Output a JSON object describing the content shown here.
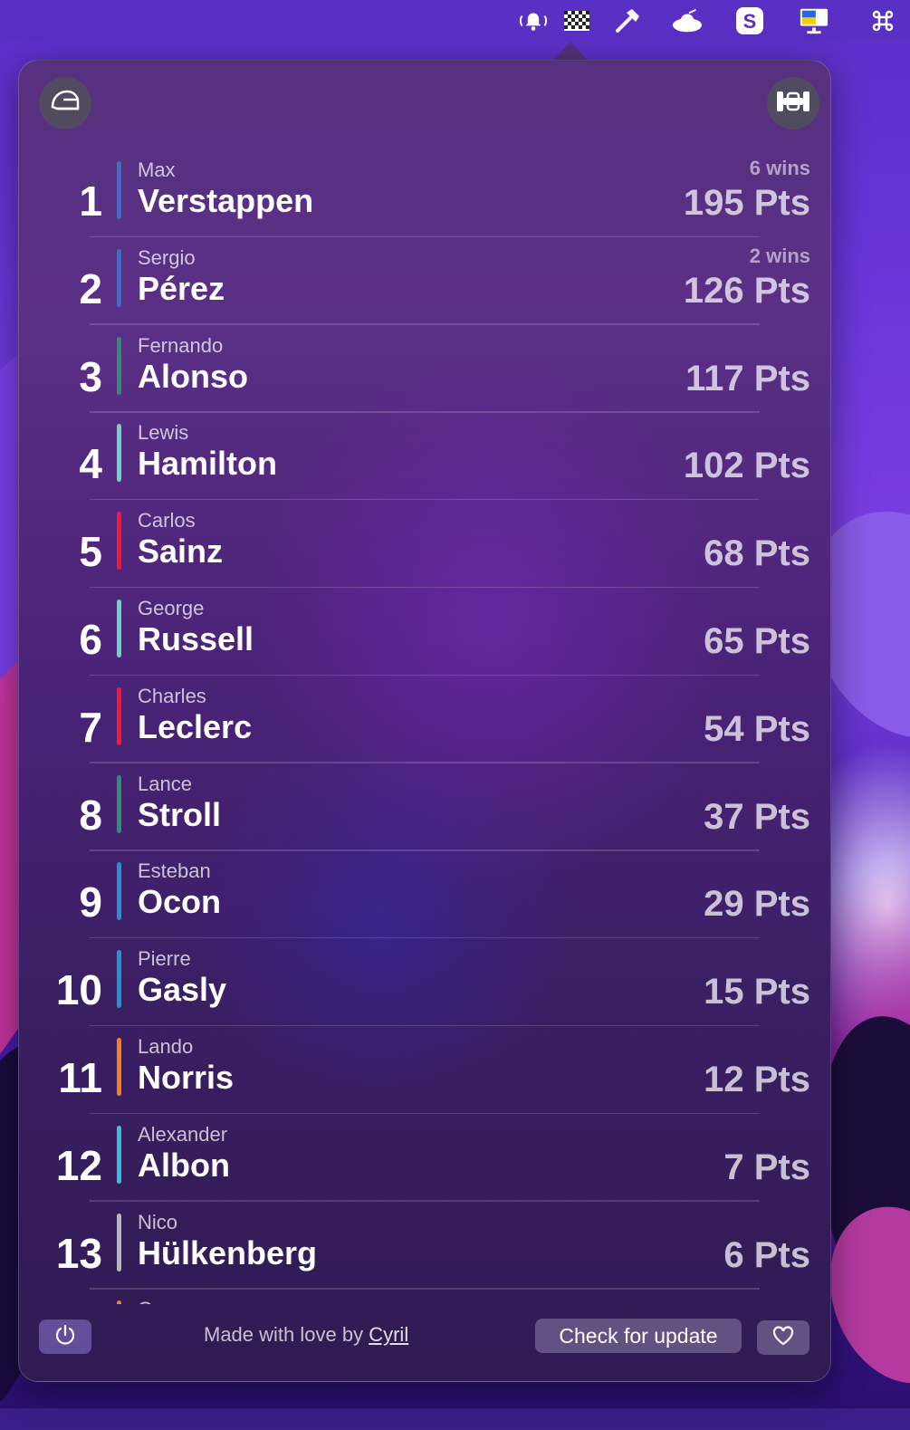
{
  "menubar": {
    "icons": [
      "bell-broadcast-icon",
      "checkered-flag-icon",
      "hammer-icon",
      "flying-saucer-icon",
      "s-app-icon",
      "display-flag-icon",
      "command-key-icon"
    ]
  },
  "header": {
    "left_icon": "helmet-icon",
    "right_icon": "f1-car-icon"
  },
  "standings": [
    {
      "position": "1",
      "first": "Max",
      "last": "Verstappen",
      "wins": "6 wins",
      "points": "195 Pts",
      "team_color": "#3671C6"
    },
    {
      "position": "2",
      "first": "Sergio",
      "last": "Pérez",
      "wins": "2 wins",
      "points": "126 Pts",
      "team_color": "#3671C6"
    },
    {
      "position": "3",
      "first": "Fernando",
      "last": "Alonso",
      "wins": "",
      "points": "117 Pts",
      "team_color": "#358C75"
    },
    {
      "position": "4",
      "first": "Lewis",
      "last": "Hamilton",
      "wins": "",
      "points": "102 Pts",
      "team_color": "#6CD3BF"
    },
    {
      "position": "5",
      "first": "Carlos",
      "last": "Sainz",
      "wins": "",
      "points": "68 Pts",
      "team_color": "#F91536"
    },
    {
      "position": "6",
      "first": "George",
      "last": "Russell",
      "wins": "",
      "points": "65 Pts",
      "team_color": "#6CD3BF"
    },
    {
      "position": "7",
      "first": "Charles",
      "last": "Leclerc",
      "wins": "",
      "points": "54 Pts",
      "team_color": "#F91536"
    },
    {
      "position": "8",
      "first": "Lance",
      "last": "Stroll",
      "wins": "",
      "points": "37 Pts",
      "team_color": "#358C75"
    },
    {
      "position": "9",
      "first": "Esteban",
      "last": "Ocon",
      "wins": "",
      "points": "29 Pts",
      "team_color": "#2293D1"
    },
    {
      "position": "10",
      "first": "Pierre",
      "last": "Gasly",
      "wins": "",
      "points": "15 Pts",
      "team_color": "#2293D1"
    },
    {
      "position": "11",
      "first": "Lando",
      "last": "Norris",
      "wins": "",
      "points": "12 Pts",
      "team_color": "#F58020"
    },
    {
      "position": "12",
      "first": "Alexander",
      "last": "Albon",
      "wins": "",
      "points": "7 Pts",
      "team_color": "#37BEDD"
    },
    {
      "position": "13",
      "first": "Nico",
      "last": "Hülkenberg",
      "wins": "",
      "points": "6 Pts",
      "team_color": "#B6BABD"
    },
    {
      "position": "",
      "first": "Oscar",
      "last": "",
      "wins": "",
      "points": "",
      "team_color": "#F58020"
    }
  ],
  "footer": {
    "credit_prefix": "Made with love by",
    "credit_link": "Cyril",
    "update_label": "Check for update",
    "power_icon": "power-icon",
    "heart_icon": "heart-icon"
  }
}
